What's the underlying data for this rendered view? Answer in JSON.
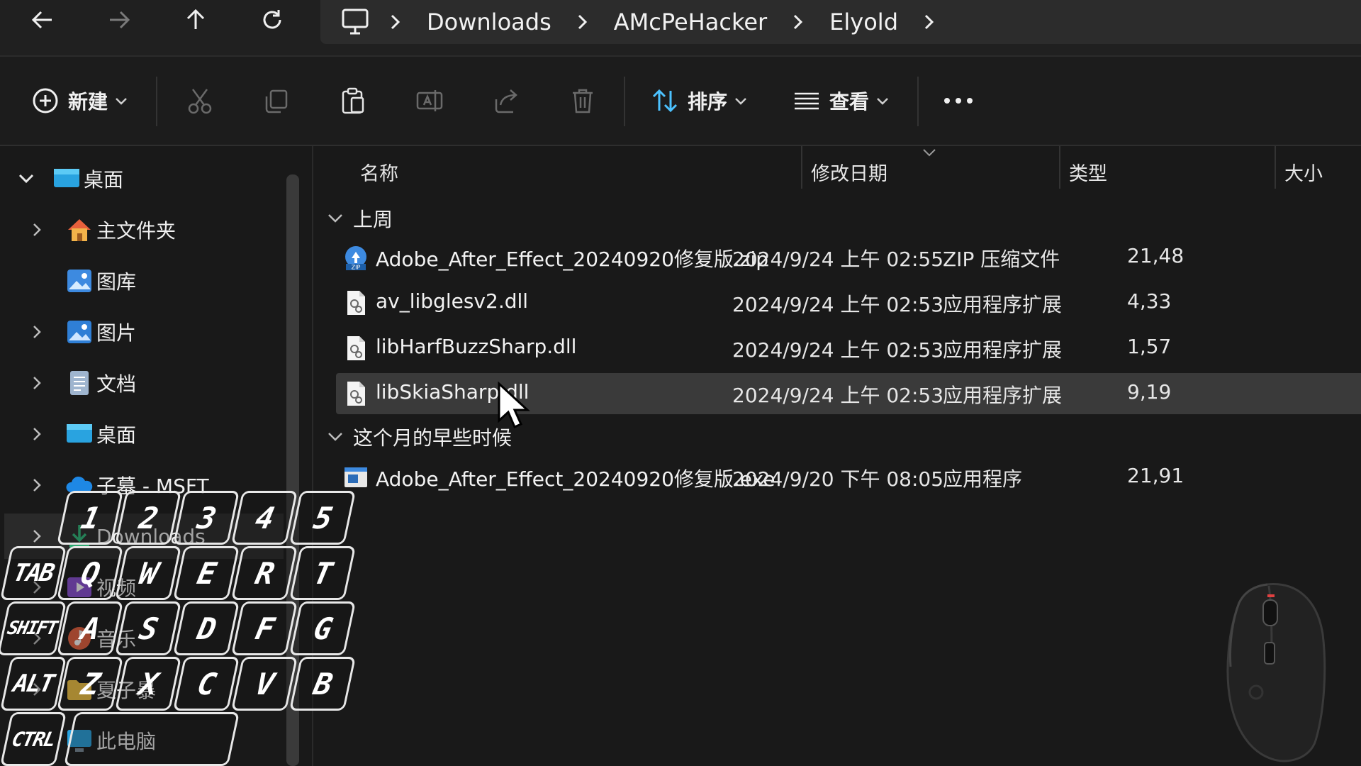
{
  "breadcrumb": {
    "items": [
      "Downloads",
      "AMcPeHacker",
      "Elyold"
    ]
  },
  "toolbar": {
    "new_label": "新建",
    "sort_label": "排序",
    "view_label": "查看"
  },
  "sidebar": {
    "items": [
      {
        "label": "桌面",
        "icon": "desktop-icon"
      },
      {
        "label": "主文件夹",
        "icon": "home-icon"
      },
      {
        "label": "图库",
        "icon": "gallery-icon"
      },
      {
        "label": "图片",
        "icon": "pictures-icon"
      },
      {
        "label": "文档",
        "icon": "documents-icon"
      },
      {
        "label": "桌面",
        "icon": "desktop-icon"
      },
      {
        "label": "子墓 - MSFT",
        "icon": "onedrive-icon"
      },
      {
        "label": "Downloads",
        "icon": "downloads-icon"
      },
      {
        "label": "视频",
        "icon": "videos-icon"
      },
      {
        "label": "音乐",
        "icon": "music-icon"
      },
      {
        "label": "夏子暴",
        "icon": "folder-icon"
      },
      {
        "label": "此电脑",
        "icon": "computer-icon"
      }
    ]
  },
  "columns": {
    "name": "名称",
    "date": "修改日期",
    "type": "类型",
    "size": "大小"
  },
  "groups": [
    {
      "label": "上周",
      "files": [
        {
          "name": "Adobe_After_Effect_20240920修复版.zip",
          "date": "2024/9/24 上午 02:55",
          "type": "ZIP 压缩文件",
          "size": "21,48",
          "icon": "zip-icon"
        },
        {
          "name": "av_libglesv2.dll",
          "date": "2024/9/24 上午 02:53",
          "type": "应用程序扩展",
          "size": "4,33",
          "icon": "dll-icon"
        },
        {
          "name": "libHarfBuzzSharp.dll",
          "date": "2024/9/24 上午 02:53",
          "type": "应用程序扩展",
          "size": "1,57",
          "icon": "dll-icon"
        },
        {
          "name": "libSkiaSharp.dll",
          "date": "2024/9/24 上午 02:53",
          "type": "应用程序扩展",
          "size": "9,19",
          "icon": "dll-icon",
          "selected": true
        }
      ]
    },
    {
      "label": "这个月的早些时候",
      "files": [
        {
          "name": "Adobe_After_Effect_20240920修复版.exe",
          "date": "2024/9/20 下午 08:05",
          "type": "应用程序",
          "size": "21,91",
          "icon": "exe-icon"
        }
      ]
    }
  ],
  "keyboard": {
    "row1": [
      "1",
      "2",
      "3",
      "4",
      "5"
    ],
    "row2": [
      "TAB",
      "Q",
      "W",
      "E",
      "R",
      "T"
    ],
    "row3": [
      "SHIFT",
      "A",
      "S",
      "D",
      "F",
      "G"
    ],
    "row4": [
      "ALT",
      "Z",
      "X",
      "C",
      "V",
      "B"
    ],
    "row5": [
      "CTRL",
      ""
    ]
  },
  "colors": {
    "background": "#191919",
    "selection": "#3a3a3a",
    "accent": "#4cc2ff"
  }
}
